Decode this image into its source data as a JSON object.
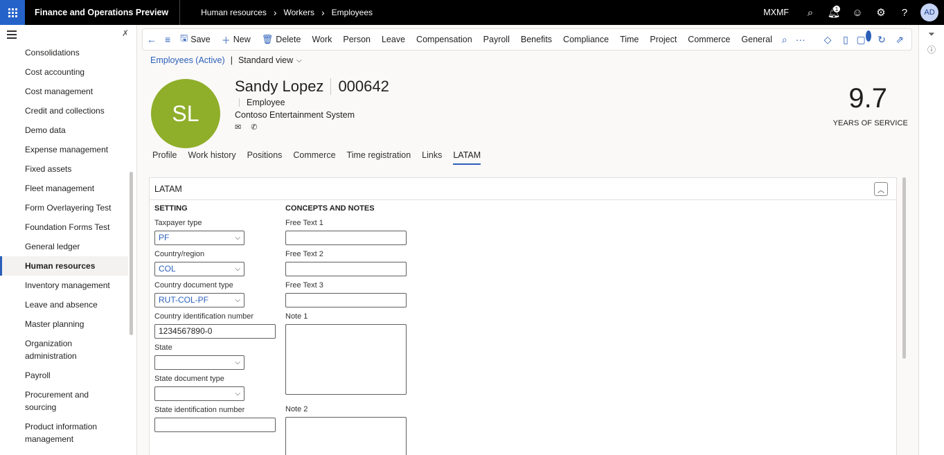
{
  "topbar": {
    "app_title": "Finance and Operations Preview",
    "breadcrumbs": [
      "Human resources",
      "Workers",
      "Employees"
    ],
    "company": "MXMF",
    "notification_count": "1",
    "user_initials": "AD"
  },
  "sidebar": {
    "items": [
      {
        "label": "Consolidations"
      },
      {
        "label": "Cost accounting"
      },
      {
        "label": "Cost management"
      },
      {
        "label": "Credit and collections"
      },
      {
        "label": "Demo data"
      },
      {
        "label": "Expense management"
      },
      {
        "label": "Fixed assets"
      },
      {
        "label": "Fleet management"
      },
      {
        "label": "Form Overlayering Test"
      },
      {
        "label": "Foundation Forms Test"
      },
      {
        "label": "General ledger"
      },
      {
        "label": "Human resources",
        "active": true
      },
      {
        "label": "Inventory management"
      },
      {
        "label": "Leave and absence"
      },
      {
        "label": "Master planning"
      },
      {
        "label": "Organization administration"
      },
      {
        "label": "Payroll"
      },
      {
        "label": "Procurement and sourcing"
      },
      {
        "label": "Product information management"
      }
    ]
  },
  "actionbar": {
    "save": "Save",
    "new": "New",
    "delete": "Delete",
    "menus": [
      "Work",
      "Person",
      "Leave",
      "Compensation",
      "Payroll",
      "Benefits",
      "Compliance",
      "Time",
      "Project",
      "Commerce",
      "General"
    ],
    "attachments_count": "0"
  },
  "view": {
    "list_link": "Employees (Active)",
    "view_name": "Standard view"
  },
  "employee": {
    "initials": "SL",
    "name": "Sandy Lopez",
    "number": "000642",
    "type": "Employee",
    "company": "Contoso Entertainment System",
    "years_of_service": "9.7",
    "years_label": "YEARS OF SERVICE",
    "avatar_color": "#8fae2a"
  },
  "tabs": [
    "Profile",
    "Work history",
    "Positions",
    "Commerce",
    "Time registration",
    "Links",
    "LATAM"
  ],
  "active_tab": "LATAM",
  "latam": {
    "title": "LATAM",
    "setting": {
      "title": "SETTING",
      "taxpayer_type_label": "Taxpayer type",
      "taxpayer_type_value": "PF",
      "country_label": "Country/region",
      "country_value": "COL",
      "country_doc_type_label": "Country document type",
      "country_doc_type_value": "RUT-COL-PF",
      "country_id_label": "Country identification number",
      "country_id_value": "1234567890-0",
      "state_label": "State",
      "state_value": "",
      "state_doc_type_label": "State document type",
      "state_doc_type_value": "",
      "state_id_label": "State identification number",
      "state_id_value": ""
    },
    "concepts": {
      "title": "CONCEPTS AND NOTES",
      "free_text_1_label": "Free Text 1",
      "free_text_2_label": "Free Text 2",
      "free_text_3_label": "Free Text 3",
      "note_1_label": "Note 1",
      "note_2_label": "Note 2"
    }
  },
  "colors": {
    "accent": "#2b5fb9",
    "topbar": "#000000",
    "waffle": "#2563c9"
  }
}
